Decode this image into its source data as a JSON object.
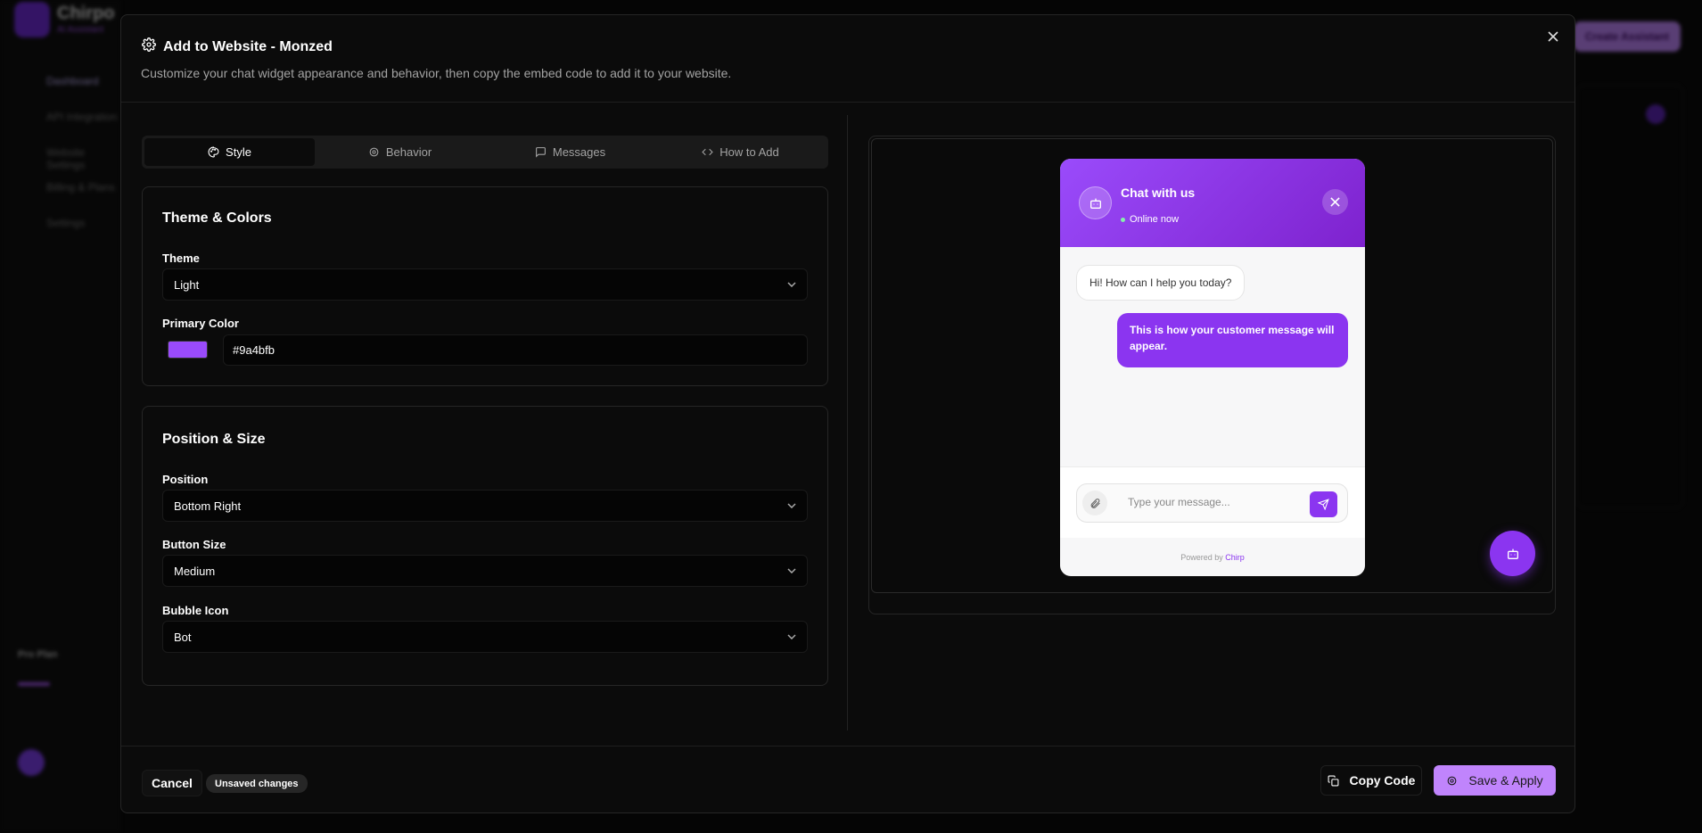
{
  "background": {
    "brand": "Chirpo",
    "brand_sub": "AI Assistant",
    "nav": [
      "Dashboard",
      "API Integration",
      "Website Settings",
      "Billing & Plans",
      "Settings"
    ],
    "plan": "Pro Plan",
    "create_label": "Create Assistant"
  },
  "modal": {
    "title": "Add to Website - Monzed",
    "description": "Customize your chat widget appearance and behavior, then copy the embed code to add it to your website."
  },
  "tabs": [
    {
      "label": "Style",
      "icon": "palette-icon",
      "active": true
    },
    {
      "label": "Behavior",
      "icon": "gear-icon",
      "active": false
    },
    {
      "label": "Messages",
      "icon": "message-icon",
      "active": false
    },
    {
      "label": "How to Add",
      "icon": "code-icon",
      "active": false
    }
  ],
  "theme_card": {
    "title": "Theme & Colors",
    "theme_label": "Theme",
    "theme_value": "Light",
    "color_label": "Primary Color",
    "color_value": "#9a4bfb"
  },
  "position_card": {
    "title": "Position & Size",
    "position_label": "Position",
    "position_value": "Bottom Right",
    "size_label": "Button Size",
    "size_value": "Medium",
    "icon_label": "Bubble Icon",
    "icon_value": "Bot"
  },
  "preview": {
    "header_title": "Chat with us",
    "status": "Online now",
    "bot_message": "Hi! How can I help you today?",
    "user_message": "This is how your customer message will appear.",
    "input_placeholder": "Type your message...",
    "powered_prefix": "Powered by",
    "powered_brand": "Chirp",
    "accent_color": "#9a4bfb"
  },
  "footer": {
    "cancel_label": "Cancel",
    "unsaved_label": "Unsaved changes",
    "copy_label": "Copy Code",
    "save_label": "Save & Apply"
  }
}
